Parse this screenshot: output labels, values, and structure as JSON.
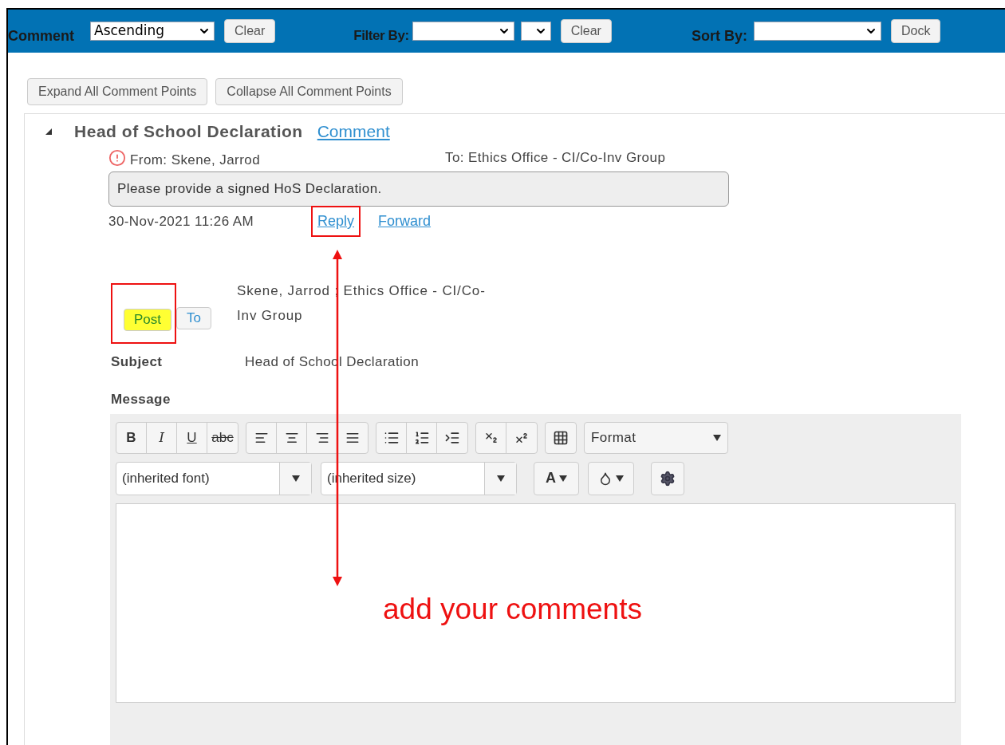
{
  "top_bar": {
    "comment_label": "Comment",
    "order_select": "Ascending",
    "clear_button": "Clear",
    "filter_label": "Filter By:",
    "filter_clear_button": "Clear",
    "sort_label": "Sort By:",
    "dock_button": "Dock"
  },
  "tree_buttons": [
    "Expand All Comment Points",
    "Collapse All Comment Points"
  ],
  "comment_point": {
    "title": "Head of School Declaration",
    "expanded": true,
    "comment_link": "Comment",
    "from": "From: Skene, Jarrod",
    "to": "To: Ethics Office - CI/Co-Inv Group",
    "message": "Please provide a signed HoS Declaration.",
    "date": "30-Nov-2021 11:26 AM",
    "links": [
      {
        "label": "Reply",
        "boxed": true
      },
      {
        "label": "Forward",
        "boxed": false
      }
    ]
  },
  "reply_form": {
    "recipients": "Skene, Jarrod ; Ethics Office - CI/Co-Inv Group",
    "buttons": [
      {
        "label": "Post",
        "boxed": true,
        "highlighted": true
      },
      {
        "label": "To",
        "boxed": false,
        "highlighted": false
      }
    ],
    "subject_label": "Subject",
    "subject": "Head of School Declaration",
    "message_label": "Message",
    "editor": {
      "style_buttons": [
        {
          "kind": "bold",
          "label": "B"
        },
        {
          "kind": "italic",
          "label": "I"
        },
        {
          "kind": "underline",
          "label": "U"
        },
        {
          "kind": "strike",
          "label": "abc"
        }
      ],
      "format": "Format",
      "font": "(inherited font)",
      "size": "(inherited size)",
      "text_color_label": "A"
    }
  },
  "annotation": {
    "text": "add your comments"
  }
}
